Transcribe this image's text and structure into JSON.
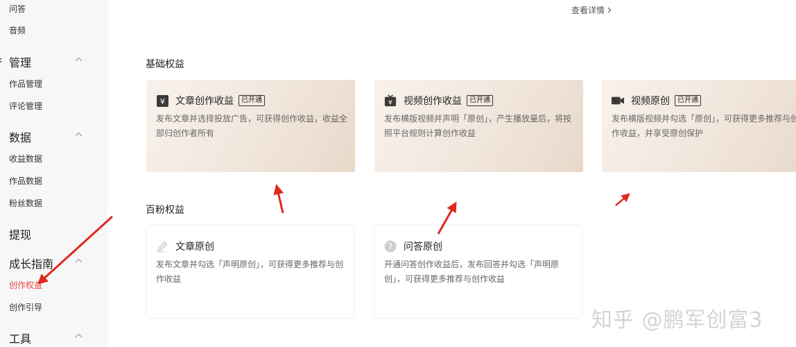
{
  "sidebar": {
    "top_items": [
      "问答",
      "音频"
    ],
    "groups": [
      {
        "label": "管理",
        "items": [
          "作品管理",
          "评论管理"
        ]
      },
      {
        "label": "数据",
        "items": [
          "收益数据",
          "作品数据",
          "粉丝数据"
        ]
      },
      {
        "label": "提现",
        "items": []
      },
      {
        "label": "成长指南",
        "items": [
          "创作权益",
          "创作引导"
        ]
      },
      {
        "label": "工具",
        "items": []
      }
    ],
    "active_item": "创作权益",
    "active_color": "#e8453c"
  },
  "main": {
    "detail_link": "查看详情",
    "sections": [
      {
        "title": "基础权益",
        "cards": [
          {
            "title": "文章创作收益",
            "badge": "已开通",
            "icon": "yen-icon",
            "desc": "发布文章并选择投放广告，可获得创作收益，收益全部归创作者所有"
          },
          {
            "title": "视频创作收益",
            "badge": "已开通",
            "icon": "tv-yen-icon",
            "desc": "发布横版视频并声明「原创」，产生播放量后，将按照平台规则计算创作收益"
          },
          {
            "title": "视频原创",
            "badge": "已开通",
            "icon": "video-camera-icon",
            "desc": "发布横版视频并勾选「原创」，可获得更多推荐与创作收益，并享受原创保护"
          }
        ]
      },
      {
        "title": "百粉权益",
        "cards": [
          {
            "title": "文章原创",
            "icon": "pen-icon",
            "desc": "发布文章并勾选「声明原创」，可获得更多推荐与创作收益"
          },
          {
            "title": "问答原创",
            "icon": "question-icon",
            "desc": "开通问答创作收益后，发布回答并勾选「声明原创」，可获得更多推荐与创作收益"
          }
        ]
      }
    ]
  },
  "watermark": "知乎 @鹏军创富3",
  "colors": {
    "arrow": "#e0281f",
    "premium_card_from": "#f8f2ec",
    "premium_card_to": "#e8d8ca"
  }
}
